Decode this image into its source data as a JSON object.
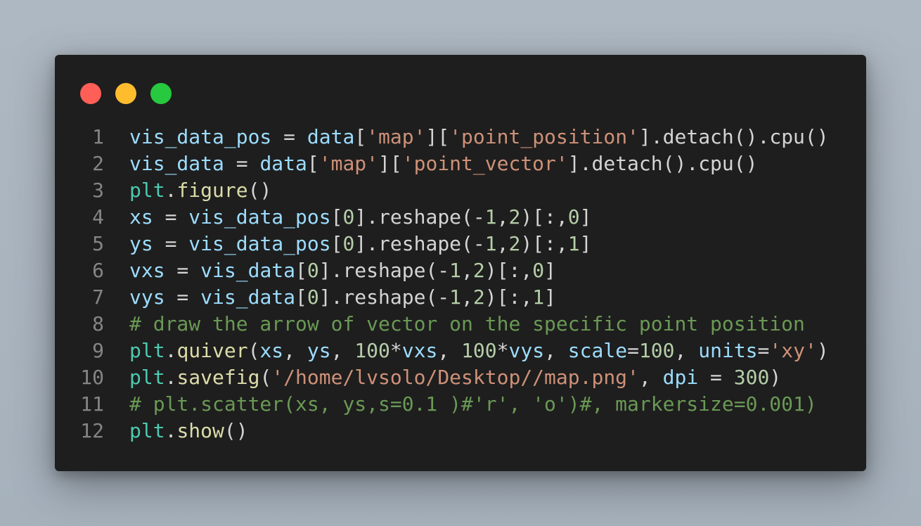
{
  "window": {
    "controls": [
      {
        "name": "close",
        "color": "#ff5f56"
      },
      {
        "name": "minimize",
        "color": "#ffbd2e"
      },
      {
        "name": "maximize",
        "color": "#27c93f"
      }
    ]
  },
  "code": {
    "lines": [
      {
        "n": "1",
        "tokens": [
          {
            "t": "vis_data_pos",
            "k": "var"
          },
          {
            "t": " = ",
            "k": "op"
          },
          {
            "t": "data",
            "k": "var"
          },
          {
            "t": "[",
            "k": "op"
          },
          {
            "t": "'map'",
            "k": "str"
          },
          {
            "t": "][",
            "k": "op"
          },
          {
            "t": "'point_position'",
            "k": "str"
          },
          {
            "t": "].detach().cpu()",
            "k": "op"
          }
        ]
      },
      {
        "n": "2",
        "tokens": [
          {
            "t": "vis_data",
            "k": "var"
          },
          {
            "t": " = ",
            "k": "op"
          },
          {
            "t": "data",
            "k": "var"
          },
          {
            "t": "[",
            "k": "op"
          },
          {
            "t": "'map'",
            "k": "str"
          },
          {
            "t": "][",
            "k": "op"
          },
          {
            "t": "'point_vector'",
            "k": "str"
          },
          {
            "t": "].detach().cpu()",
            "k": "op"
          }
        ]
      },
      {
        "n": "3",
        "tokens": [
          {
            "t": "plt",
            "k": "cls"
          },
          {
            "t": ".",
            "k": "op"
          },
          {
            "t": "figure",
            "k": "fn"
          },
          {
            "t": "()",
            "k": "op"
          }
        ]
      },
      {
        "n": "4",
        "tokens": [
          {
            "t": "xs",
            "k": "var"
          },
          {
            "t": " = ",
            "k": "op"
          },
          {
            "t": "vis_data_pos",
            "k": "var"
          },
          {
            "t": "[",
            "k": "op"
          },
          {
            "t": "0",
            "k": "num"
          },
          {
            "t": "].reshape(-",
            "k": "op"
          },
          {
            "t": "1",
            "k": "num"
          },
          {
            "t": ",",
            "k": "op"
          },
          {
            "t": "2",
            "k": "num"
          },
          {
            "t": ")[:,",
            "k": "op"
          },
          {
            "t": "0",
            "k": "num"
          },
          {
            "t": "]",
            "k": "op"
          }
        ]
      },
      {
        "n": "5",
        "tokens": [
          {
            "t": "ys",
            "k": "var"
          },
          {
            "t": " = ",
            "k": "op"
          },
          {
            "t": "vis_data_pos",
            "k": "var"
          },
          {
            "t": "[",
            "k": "op"
          },
          {
            "t": "0",
            "k": "num"
          },
          {
            "t": "].reshape(-",
            "k": "op"
          },
          {
            "t": "1",
            "k": "num"
          },
          {
            "t": ",",
            "k": "op"
          },
          {
            "t": "2",
            "k": "num"
          },
          {
            "t": ")[:,",
            "k": "op"
          },
          {
            "t": "1",
            "k": "num"
          },
          {
            "t": "]",
            "k": "op"
          }
        ]
      },
      {
        "n": "6",
        "tokens": [
          {
            "t": "vxs",
            "k": "var"
          },
          {
            "t": " = ",
            "k": "op"
          },
          {
            "t": "vis_data",
            "k": "var"
          },
          {
            "t": "[",
            "k": "op"
          },
          {
            "t": "0",
            "k": "num"
          },
          {
            "t": "].reshape(-",
            "k": "op"
          },
          {
            "t": "1",
            "k": "num"
          },
          {
            "t": ",",
            "k": "op"
          },
          {
            "t": "2",
            "k": "num"
          },
          {
            "t": ")[:,",
            "k": "op"
          },
          {
            "t": "0",
            "k": "num"
          },
          {
            "t": "]",
            "k": "op"
          }
        ]
      },
      {
        "n": "7",
        "tokens": [
          {
            "t": "vys",
            "k": "var"
          },
          {
            "t": " = ",
            "k": "op"
          },
          {
            "t": "vis_data",
            "k": "var"
          },
          {
            "t": "[",
            "k": "op"
          },
          {
            "t": "0",
            "k": "num"
          },
          {
            "t": "].reshape(-",
            "k": "op"
          },
          {
            "t": "1",
            "k": "num"
          },
          {
            "t": ",",
            "k": "op"
          },
          {
            "t": "2",
            "k": "num"
          },
          {
            "t": ")[:,",
            "k": "op"
          },
          {
            "t": "1",
            "k": "num"
          },
          {
            "t": "]",
            "k": "op"
          }
        ]
      },
      {
        "n": "8",
        "tokens": [
          {
            "t": "# draw the arrow of vector on the specific point position",
            "k": "cmt"
          }
        ]
      },
      {
        "n": "9",
        "tokens": [
          {
            "t": "plt",
            "k": "cls"
          },
          {
            "t": ".",
            "k": "op"
          },
          {
            "t": "quiver",
            "k": "fn"
          },
          {
            "t": "(",
            "k": "op"
          },
          {
            "t": "xs",
            "k": "var"
          },
          {
            "t": ", ",
            "k": "op"
          },
          {
            "t": "ys",
            "k": "var"
          },
          {
            "t": ", ",
            "k": "op"
          },
          {
            "t": "100",
            "k": "num"
          },
          {
            "t": "*",
            "k": "op"
          },
          {
            "t": "vxs",
            "k": "var"
          },
          {
            "t": ", ",
            "k": "op"
          },
          {
            "t": "100",
            "k": "num"
          },
          {
            "t": "*",
            "k": "op"
          },
          {
            "t": "vys",
            "k": "var"
          },
          {
            "t": ", ",
            "k": "op"
          },
          {
            "t": "scale",
            "k": "var"
          },
          {
            "t": "=",
            "k": "op"
          },
          {
            "t": "100",
            "k": "num"
          },
          {
            "t": ", ",
            "k": "op"
          },
          {
            "t": "units",
            "k": "var"
          },
          {
            "t": "=",
            "k": "op"
          },
          {
            "t": "'xy'",
            "k": "str"
          },
          {
            "t": ")",
            "k": "op"
          }
        ]
      },
      {
        "n": "10",
        "tokens": [
          {
            "t": "plt",
            "k": "cls"
          },
          {
            "t": ".",
            "k": "op"
          },
          {
            "t": "savefig",
            "k": "fn"
          },
          {
            "t": "(",
            "k": "op"
          },
          {
            "t": "'/home/lvsolo/Desktop//map.png'",
            "k": "str"
          },
          {
            "t": ", ",
            "k": "op"
          },
          {
            "t": "dpi",
            "k": "var"
          },
          {
            "t": " = ",
            "k": "op"
          },
          {
            "t": "300",
            "k": "num"
          },
          {
            "t": ")",
            "k": "op"
          }
        ]
      },
      {
        "n": "11",
        "tokens": [
          {
            "t": "# plt.scatter(xs, ys,s=0.1 )#'r', 'o')#, markersize=0.001)",
            "k": "cmt"
          }
        ]
      },
      {
        "n": "12",
        "tokens": [
          {
            "t": "plt",
            "k": "cls"
          },
          {
            "t": ".",
            "k": "op"
          },
          {
            "t": "show",
            "k": "fn"
          },
          {
            "t": "()",
            "k": "op"
          }
        ]
      }
    ]
  }
}
